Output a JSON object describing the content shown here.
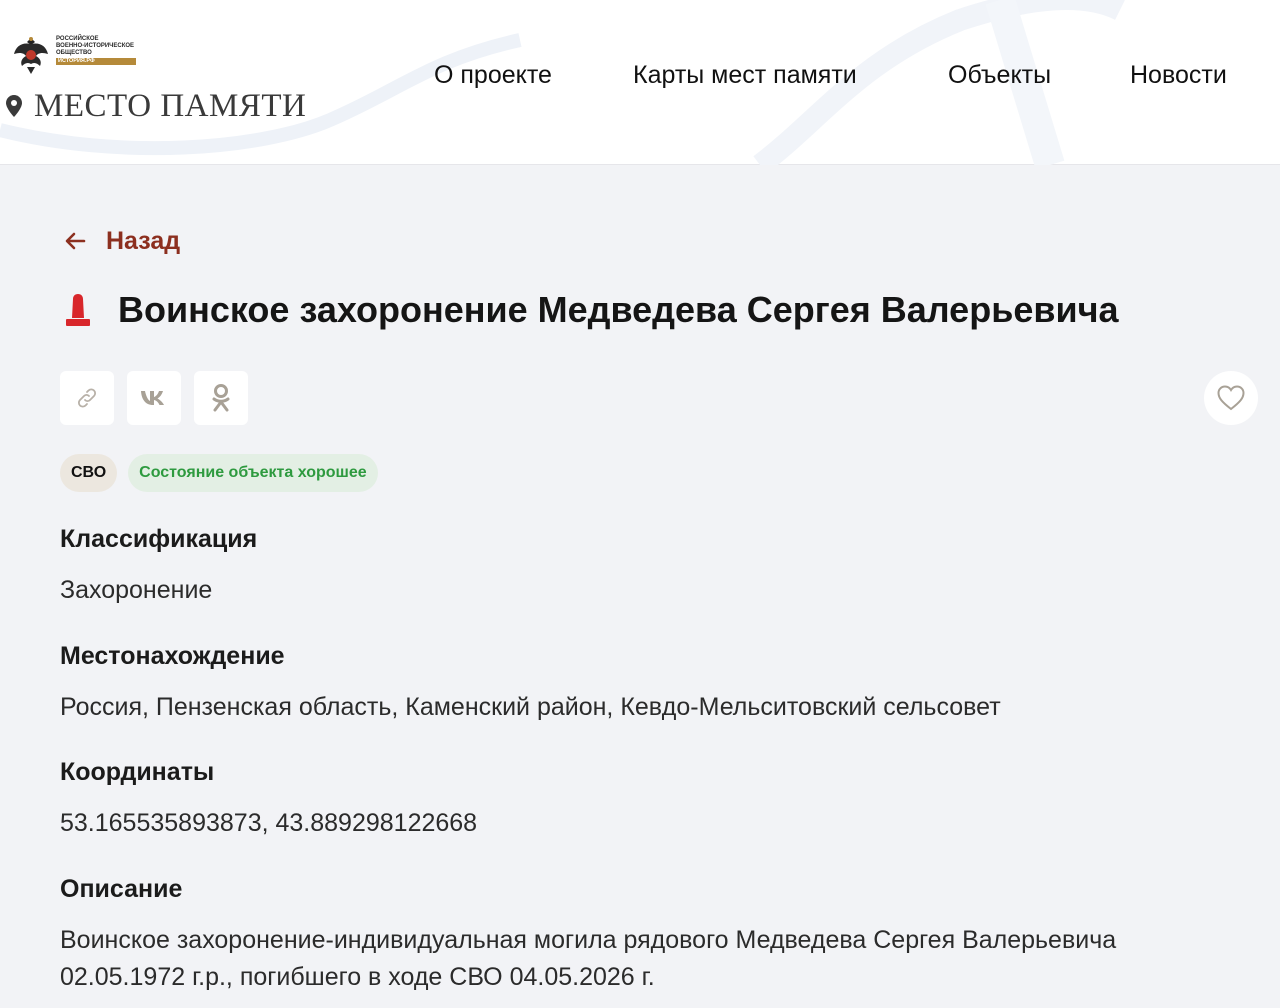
{
  "header": {
    "org": {
      "line1": "РОССИЙСКОЕ",
      "line2": "ВОЕННО-ИСТОРИЧЕСКОЕ",
      "line3": "ОБЩЕСТВО",
      "tag": "ИСТОРИЯ.РФ"
    },
    "site_title": "МЕСТО ПАМЯТИ",
    "nav": [
      {
        "label": "О проекте"
      },
      {
        "label": "Карты мест памяти"
      },
      {
        "label": "Объекты"
      },
      {
        "label": "Новости"
      }
    ]
  },
  "back": {
    "label": "Назад"
  },
  "page": {
    "title": "Воинское захоронение Медведева Сергея Валерьевича"
  },
  "share": {
    "icons": [
      "link-icon",
      "vk-icon",
      "ok-icon"
    ]
  },
  "favorite": {
    "icon": "heart-icon"
  },
  "tags": [
    {
      "label": "СВО"
    },
    {
      "label": "Состояние объекта хорошее"
    }
  ],
  "details": [
    {
      "label": "Классификация",
      "value": "Захоронение"
    },
    {
      "label": "Местонахождение",
      "value": "Россия, Пензенская область, Каменский район, Кевдо-Мельситовский сельсовет"
    },
    {
      "label": "Координаты",
      "value": "53.165535893873, 43.889298122668"
    },
    {
      "label": "Описание",
      "value": "Воинское захоронение-индивидуальная могила рядового Медведева Сергея Валерьевича 02.05.1972 г.р., погибшего в ходе СВО 04.05.2026 г."
    }
  ],
  "colors": {
    "accent": "#8c2f1f",
    "monument": "#d8262b",
    "state_green": "#2e9a3f",
    "page_bg": "#f2f3f6"
  }
}
